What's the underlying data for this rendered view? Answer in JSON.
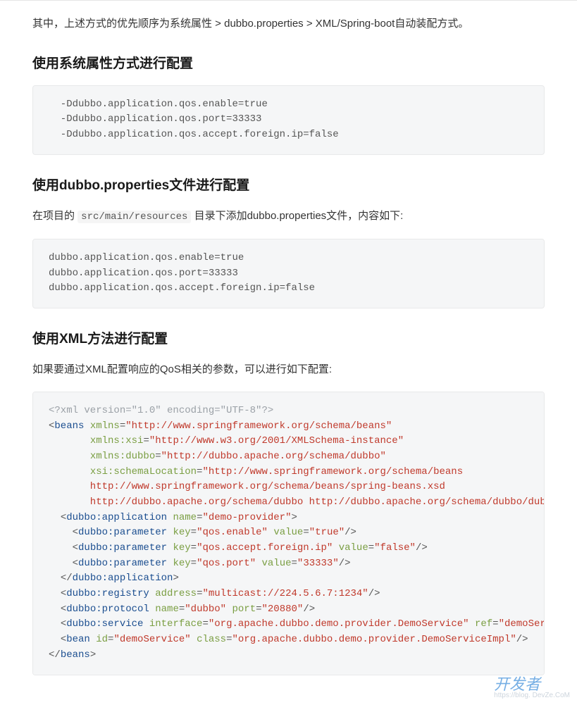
{
  "intro": "其中，上述方式的优先顺序为系统属性 > dubbo.properties > XML/Spring-boot自动装配方式。",
  "section1": {
    "heading": "使用系统属性方式进行配置",
    "code": "  -Ddubbo.application.qos.enable=true\n  -Ddubbo.application.qos.port=33333\n  -Ddubbo.application.qos.accept.foreign.ip=false"
  },
  "section2": {
    "heading": "使用dubbo.properties文件进行配置",
    "para_before": "在项目的 ",
    "para_code": "src/main/resources",
    "para_after": " 目录下添加dubbo.properties文件，内容如下:",
    "code": "dubbo.application.qos.enable=true\ndubbo.application.qos.port=33333\ndubbo.application.qos.accept.foreign.ip=false"
  },
  "section3": {
    "heading": "使用XML方法进行配置",
    "para": "如果要通过XML配置响应的QoS相关的参数，可以进行如下配置:",
    "xml": {
      "decl": "<?xml version=\"1.0\" encoding=\"UTF-8\"?>",
      "beans_open_tag": "beans",
      "beans_attrs": [
        {
          "indent": " ",
          "name": "xmlns",
          "val": "http://www.springframework.org/schema/beans",
          "trail": ""
        },
        {
          "indent": "       ",
          "name": "xmlns:xsi",
          "val": "http://www.w3.org/2001/XMLSchema-instance",
          "trail": ""
        },
        {
          "indent": "       ",
          "name": "xmlns:dubbo",
          "val": "http://dubbo.apache.org/schema/dubbo",
          "trail": ""
        },
        {
          "indent": "       ",
          "name": "xsi:schemaLocation",
          "val": "http://www.springframework.org/schema/beans",
          "trail": ""
        }
      ],
      "schema_extra": [
        "       http://www.springframework.org/schema/beans/spring-beans.xsd",
        "       http://dubbo.apache.org/schema/dubbo http://dubbo.apache.org/schema/dubbo/dubbo.xsd"
      ],
      "app_open": {
        "tag": "dubbo:application",
        "attrs": [
          {
            "name": "name",
            "val": "demo-provider"
          }
        ]
      },
      "params": [
        {
          "tag": "dubbo:parameter",
          "attrs": [
            {
              "name": "key",
              "val": "qos.enable"
            },
            {
              "name": "value",
              "val": "true"
            }
          ]
        },
        {
          "tag": "dubbo:parameter",
          "attrs": [
            {
              "name": "key",
              "val": "qos.accept.foreign.ip"
            },
            {
              "name": "value",
              "val": "false"
            }
          ]
        },
        {
          "tag": "dubbo:parameter",
          "attrs": [
            {
              "name": "key",
              "val": "qos.port"
            },
            {
              "name": "value",
              "val": "33333"
            }
          ]
        }
      ],
      "app_close": "dubbo:application",
      "sib": [
        {
          "tag": "dubbo:registry",
          "attrs": [
            {
              "name": "address",
              "val": "multicast://224.5.6.7:1234"
            }
          ]
        },
        {
          "tag": "dubbo:protocol",
          "attrs": [
            {
              "name": "name",
              "val": "dubbo"
            },
            {
              "name": "port",
              "val": "20880"
            }
          ]
        },
        {
          "tag": "dubbo:service",
          "attrs": [
            {
              "name": "interface",
              "val": "org.apache.dubbo.demo.provider.DemoService"
            },
            {
              "name": "ref",
              "val": "demoService"
            }
          ]
        },
        {
          "tag": "bean",
          "attrs": [
            {
              "name": "id",
              "val": "demoService"
            },
            {
              "name": "class",
              "val": "org.apache.dubbo.demo.provider.DemoServiceImpl"
            }
          ]
        }
      ],
      "beans_close": "beans"
    }
  },
  "watermark": {
    "main": "开发者",
    "sub": "https://blog. DevZe.CoM"
  }
}
